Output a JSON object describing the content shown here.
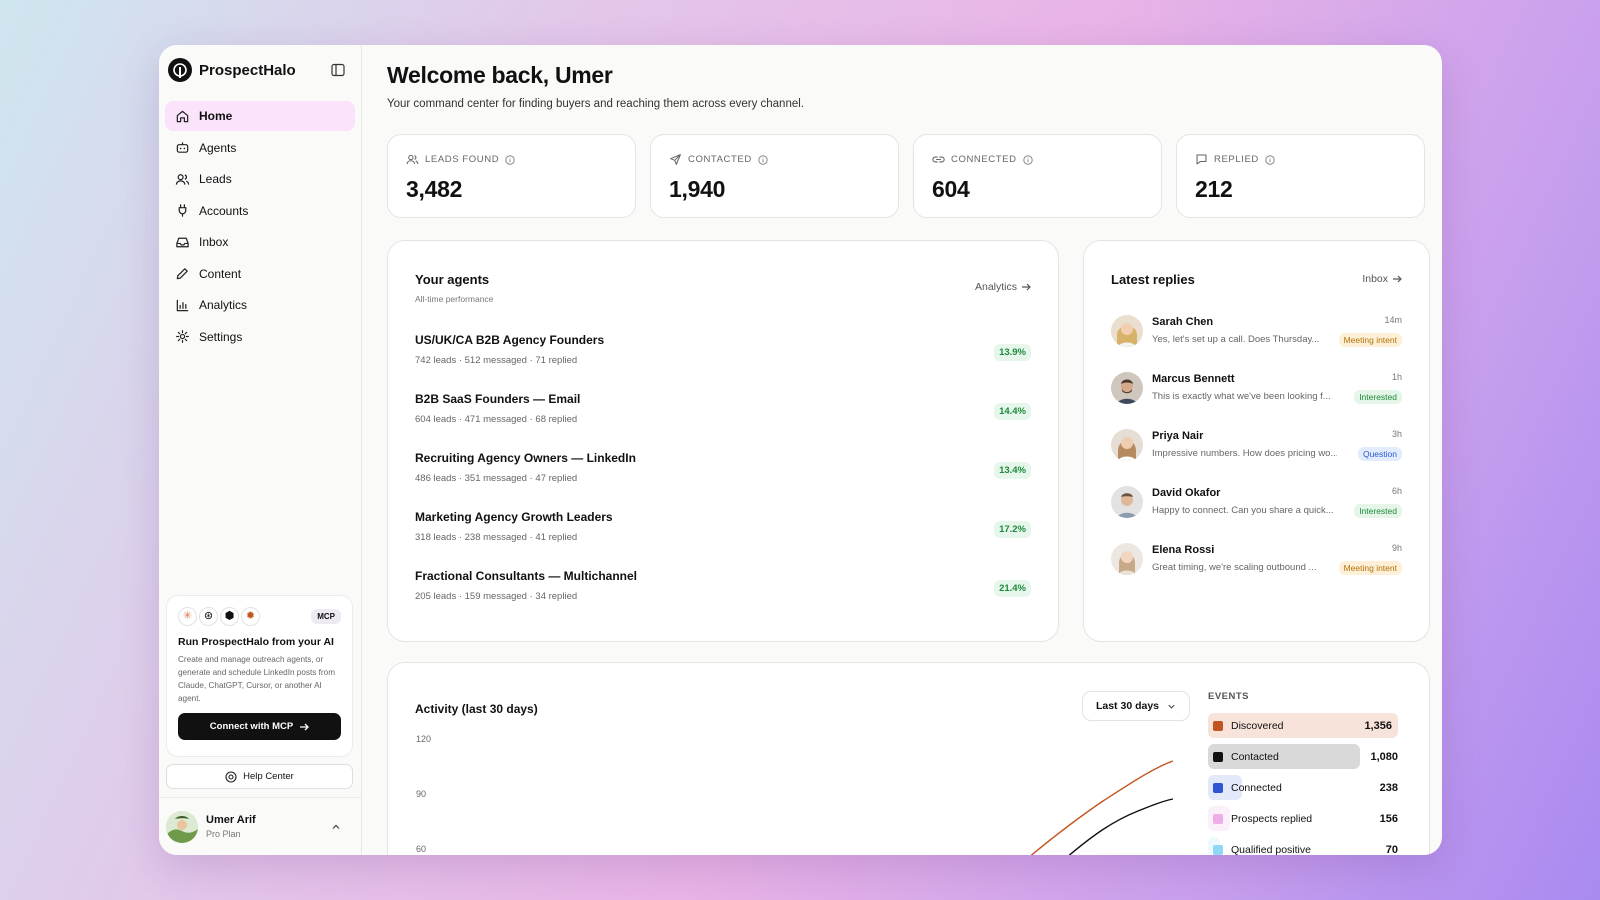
{
  "app": {
    "name": "ProspectHalo"
  },
  "nav": [
    {
      "label": "Home",
      "icon": "home-icon",
      "active": true
    },
    {
      "label": "Agents",
      "icon": "bot-icon"
    },
    {
      "label": "Leads",
      "icon": "users-icon"
    },
    {
      "label": "Accounts",
      "icon": "plug-icon"
    },
    {
      "label": "Inbox",
      "icon": "inbox-icon"
    },
    {
      "label": "Content",
      "icon": "pen-icon"
    },
    {
      "label": "Analytics",
      "icon": "bar-chart-icon"
    },
    {
      "label": "Settings",
      "icon": "gear-icon"
    }
  ],
  "mcp": {
    "badge": "MCP",
    "title": "Run ProspectHalo from your AI",
    "description": "Create and manage outreach agents, or generate and schedule LinkedIn posts from Claude, ChatGPT, Cursor, or another AI agent.",
    "button": "Connect with MCP"
  },
  "help": {
    "label": "Help Center"
  },
  "user": {
    "name": "Umer Arif",
    "plan": "Pro Plan"
  },
  "header": {
    "title": "Welcome back, Umer",
    "subtitle": "Your command center for finding buyers and reaching them across every channel."
  },
  "stats": [
    {
      "label": "LEADS FOUND",
      "value": "3,482",
      "icon": "users-icon"
    },
    {
      "label": "CONTACTED",
      "value": "1,940",
      "icon": "send-icon"
    },
    {
      "label": "CONNECTED",
      "value": "604",
      "icon": "link-icon"
    },
    {
      "label": "REPLIED",
      "value": "212",
      "icon": "message-icon"
    }
  ],
  "agents": {
    "title": "Your agents",
    "subtitle": "All-time performance",
    "link": "Analytics",
    "items": [
      {
        "name": "US/UK/CA B2B Agency Founders",
        "meta": "742 leads · 512 messaged · 71 replied",
        "rate": "13.9%"
      },
      {
        "name": "B2B SaaS Founders — Email",
        "meta": "604 leads · 471 messaged · 68 replied",
        "rate": "14.4%"
      },
      {
        "name": "Recruiting Agency Owners — LinkedIn",
        "meta": "486 leads · 351 messaged · 47 replied",
        "rate": "13.4%"
      },
      {
        "name": "Marketing Agency Growth Leaders",
        "meta": "318 leads · 238 messaged · 41 replied",
        "rate": "17.2%"
      },
      {
        "name": "Fractional Consultants — Multichannel",
        "meta": "205 leads · 159 messaged · 34 replied",
        "rate": "21.4%"
      }
    ]
  },
  "replies": {
    "title": "Latest replies",
    "link": "Inbox",
    "items": [
      {
        "name": "Sarah Chen",
        "text": "Yes, let's set up a call. Does Thursday...",
        "time": "14m",
        "tag": "Meeting intent"
      },
      {
        "name": "Marcus Bennett",
        "text": "This is exactly what we've been looking f...",
        "time": "1h",
        "tag": "Interested"
      },
      {
        "name": "Priya Nair",
        "text": "Impressive numbers. How does pricing wo...",
        "time": "3h",
        "tag": "Question"
      },
      {
        "name": "David Okafor",
        "text": "Happy to connect. Can you share a quick...",
        "time": "6h",
        "tag": "Interested"
      },
      {
        "name": "Elena Rossi",
        "text": "Great timing, we're scaling outbound ...",
        "time": "9h",
        "tag": "Meeting intent"
      }
    ]
  },
  "activity": {
    "title": "Activity (last 30 days)",
    "range": "Last 30 days",
    "ticks": [
      "120",
      "90",
      "60"
    ],
    "events_label": "EVENTS",
    "events": [
      {
        "name": "Discovered",
        "value": "1,356",
        "color": "#c2541f",
        "bg": "#f7e3da"
      },
      {
        "name": "Contacted",
        "value": "1,080",
        "color": "#111111",
        "bg": "#d9d9d9"
      },
      {
        "name": "Connected",
        "value": "238",
        "color": "#2f55d4",
        "bg": "#e3e9fb"
      },
      {
        "name": "Prospects replied",
        "value": "156",
        "color": "#f0aee8",
        "bg": "#fbeffa"
      },
      {
        "name": "Qualified positive",
        "value": "70",
        "color": "#8fd8f5",
        "bg": "#eef9fd"
      }
    ]
  },
  "chart_data": {
    "type": "line",
    "title": "Activity (last 30 days)",
    "ylim": [
      60,
      120
    ],
    "yticks": [
      120,
      90,
      60
    ],
    "series": [
      {
        "name": "Discovered",
        "color": "#c2541f"
      },
      {
        "name": "Contacted",
        "color": "#111111"
      }
    ]
  }
}
